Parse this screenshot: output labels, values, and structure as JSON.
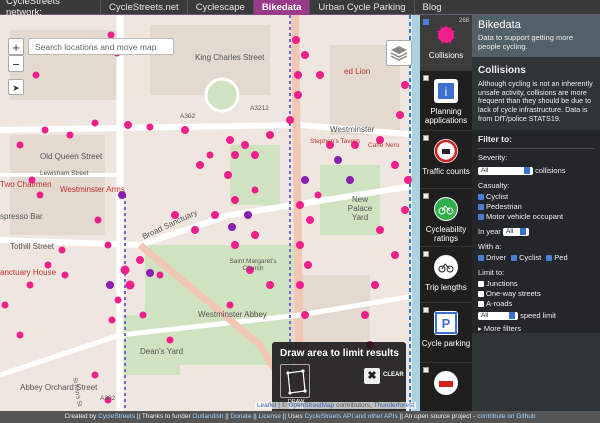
{
  "topnav": {
    "brand": "CycleStreets network:",
    "tabs": [
      "CycleStreets.net",
      "Cyclescape",
      "Bikedata",
      "Urban Cycle Parking",
      "Blog"
    ],
    "active_tab": "Bikedata"
  },
  "map": {
    "search_placeholder": "Search locations and move map",
    "zoom_in": "+",
    "zoom_out": "−",
    "labels": {
      "king_charles": "King Charles Street",
      "old_queen": "Old Queen Street",
      "lewisham": "Lewisham Street",
      "two_chairmen": "Two Chairmen",
      "westminster_arms": "Westminster Arms",
      "espresso": "spresso Bar",
      "tothill": "Tothill Street",
      "sanctuary_house": "anctuary House",
      "broad_sanctuary": "Broad Sanctuary",
      "st_margarets": "Saint Margaret's Church",
      "abbey": "Westminster Abbey",
      "deans_yard": "Dean's Yard",
      "abbey_orchard": "Abbey Orchard Street",
      "new_palace": "New Palace Yard",
      "red_lion": "ed Lion",
      "westminster": "Westminster",
      "stephens": "Stephen's Tavern",
      "caffe": "Caffè Nero",
      "a302": "A302",
      "a3212": "A3212",
      "a302b": "A302",
      "st_anns": "St Ann's St"
    },
    "attribution": {
      "leaflet": "Leaflet",
      "sep": " | © ",
      "osm": "OpenStreetMap",
      "contrib": " contributors, ",
      "thunder": "Thunderforest"
    },
    "draw": {
      "title": "Draw area to limit results",
      "button_label": "DRAW AREA",
      "clear_label": "CLEAR",
      "clear_symbol": "✖"
    }
  },
  "layers": [
    {
      "name": "Collisions",
      "count": "268",
      "active": true,
      "icon": "collision-icon",
      "checked": true
    },
    {
      "name": "Planning applications",
      "count": "",
      "active": false,
      "icon": "planning-icon",
      "checked": false
    },
    {
      "name": "Traffic counts",
      "count": "",
      "active": false,
      "icon": "traffic-icon",
      "checked": false
    },
    {
      "name": "Cycleability ratings",
      "count": "",
      "active": false,
      "icon": "cycleability-icon",
      "checked": false
    },
    {
      "name": "Trip lengths",
      "count": "",
      "active": false,
      "icon": "trip-icon",
      "checked": false
    },
    {
      "name": "Cycle parking",
      "count": "",
      "active": false,
      "icon": "parking-icon",
      "checked": false
    },
    {
      "name": "",
      "count": "",
      "active": false,
      "icon": "more-icon",
      "checked": false
    }
  ],
  "panel": {
    "title": "Bikedata",
    "subtitle": "Data to support getting more people cycling.",
    "section_title": "Collisions",
    "description": "Although cycling is not an inherently unsafe activity, collisions are more frequent than they should be due to lack of cycle infrastructure. Data is from DfT/police STATS19.",
    "filter_title": "Filter to:",
    "severity_label": "Severity:",
    "severity_value": "All",
    "severity_suffix": "collisions",
    "casualty_label": "Casualty:",
    "casualty_options": [
      "Cyclist",
      "Pedestrian",
      "Motor vehicle occupant"
    ],
    "year_label": "In year",
    "year_value": "All",
    "with_label": "With a:",
    "with_options": [
      "Driver",
      "Cyclist",
      "Ped"
    ],
    "limit_label": "Limit to:",
    "limit_options": [
      "Junctions",
      "One-way streets",
      "A-roads"
    ],
    "speed_value": "All",
    "speed_suffix": "speed limit",
    "more_filters": "More filters"
  },
  "footer": {
    "created": "Created by ",
    "cyclestreets": "CycleStreets",
    "thanks": "  ||  Thanks to funder ",
    "funder": "Outlandish",
    "donate_sep": "  ||  ",
    "donate": "Donate",
    "license_sep": "  ||  ",
    "license": "License",
    "uses": "  ||  Uses ",
    "api": "CycleStreets API and other APIs",
    "open": "  ||  An open source project - ",
    "github": "contribute on Github"
  },
  "colors": {
    "accent": "#9a3a8c",
    "marker_pink": "#f01f8c",
    "marker_purple": "#8a1fb0"
  }
}
